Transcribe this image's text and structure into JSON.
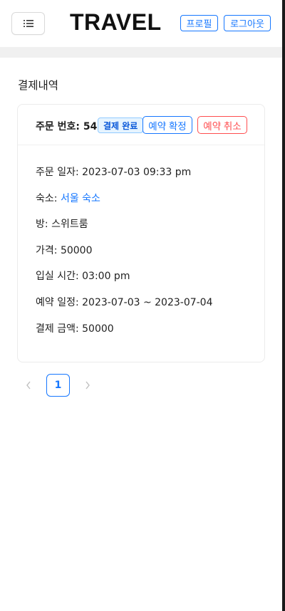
{
  "header": {
    "logo": "TRAVEL",
    "profile_label": "프로필",
    "logout_label": "로그아웃",
    "menu_icon": "list-icon"
  },
  "page": {
    "title": "결제내역"
  },
  "order": {
    "order_number": "주문 번호: 54",
    "status_tag": "결제 완료",
    "confirm_label": "예약 확정",
    "cancel_label": "예약 취소",
    "order_date_label": "주문 일자: ",
    "order_date_value": "2023-07-03 09:33 pm",
    "lodging_label": "숙소: ",
    "lodging_value": "서울 숙소",
    "room_label": "방: ",
    "room_value": "스위트룸",
    "price_label": "가격: ",
    "price_value": "50000",
    "checkin_label": "입실 시간: ",
    "checkin_value": "03:00 pm",
    "schedule_label": "예약 일정: ",
    "schedule_value": "2023-07-03 ~ 2023-07-04",
    "payment_label": "결제 금액: ",
    "payment_value": "50000"
  },
  "pagination": {
    "current_page": "1",
    "prev_icon": "chevron-left-icon",
    "next_icon": "chevron-right-icon"
  },
  "colors": {
    "primary": "#1677ff",
    "danger": "#ff4d4f",
    "tag_bg": "#e6f4ff"
  }
}
